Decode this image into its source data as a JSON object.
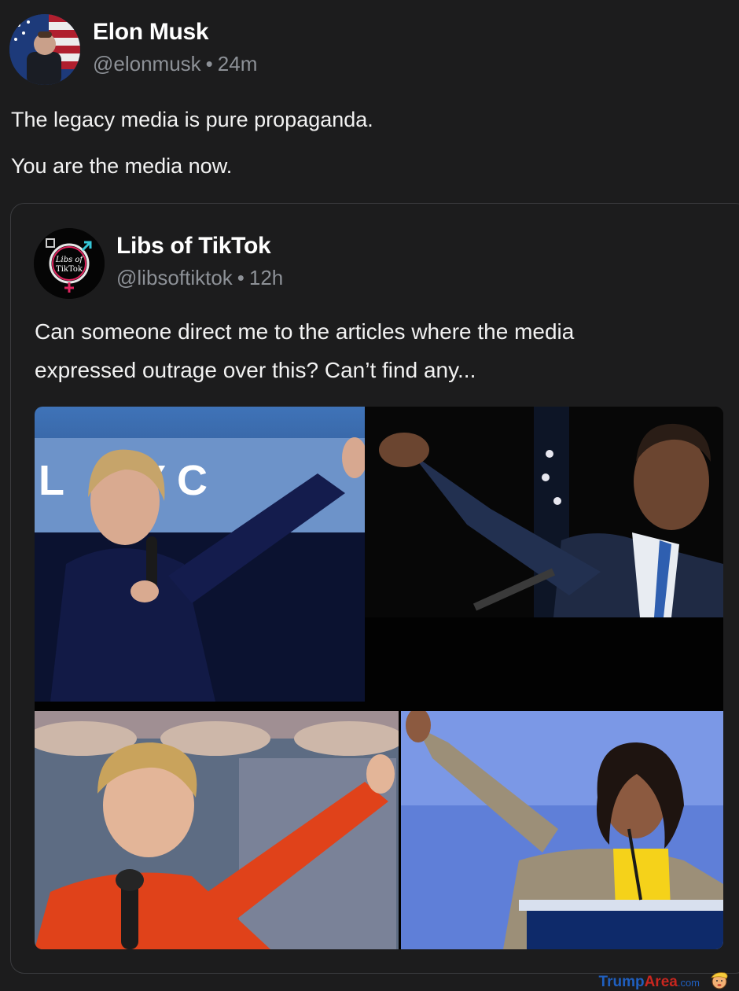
{
  "post": {
    "author_name": "Elon Musk",
    "author_handle": "@elonmusk",
    "separator": "•",
    "time": "24m",
    "text_lines": [
      "The legacy media is pure propaganda.",
      "You are the media now."
    ]
  },
  "quoted_post": {
    "author_name": "Libs of TikTok",
    "author_handle": "@libsoftiktok",
    "separator": "•",
    "time": "12h",
    "avatar_text": [
      "Libs of",
      "TikTok"
    ],
    "text_lines": [
      "Can someone direct me to the articles where the media",
      "expressed outrage over this? Can’t find any..."
    ],
    "photo_sign_text": "L  RYC"
  },
  "watermark": {
    "part1": "Trump",
    "part2": "Area",
    "part3": ".com"
  },
  "colors": {
    "background": "#1c1c1d",
    "handle_gray": "#8d9197",
    "border": "#3b3c3f"
  }
}
